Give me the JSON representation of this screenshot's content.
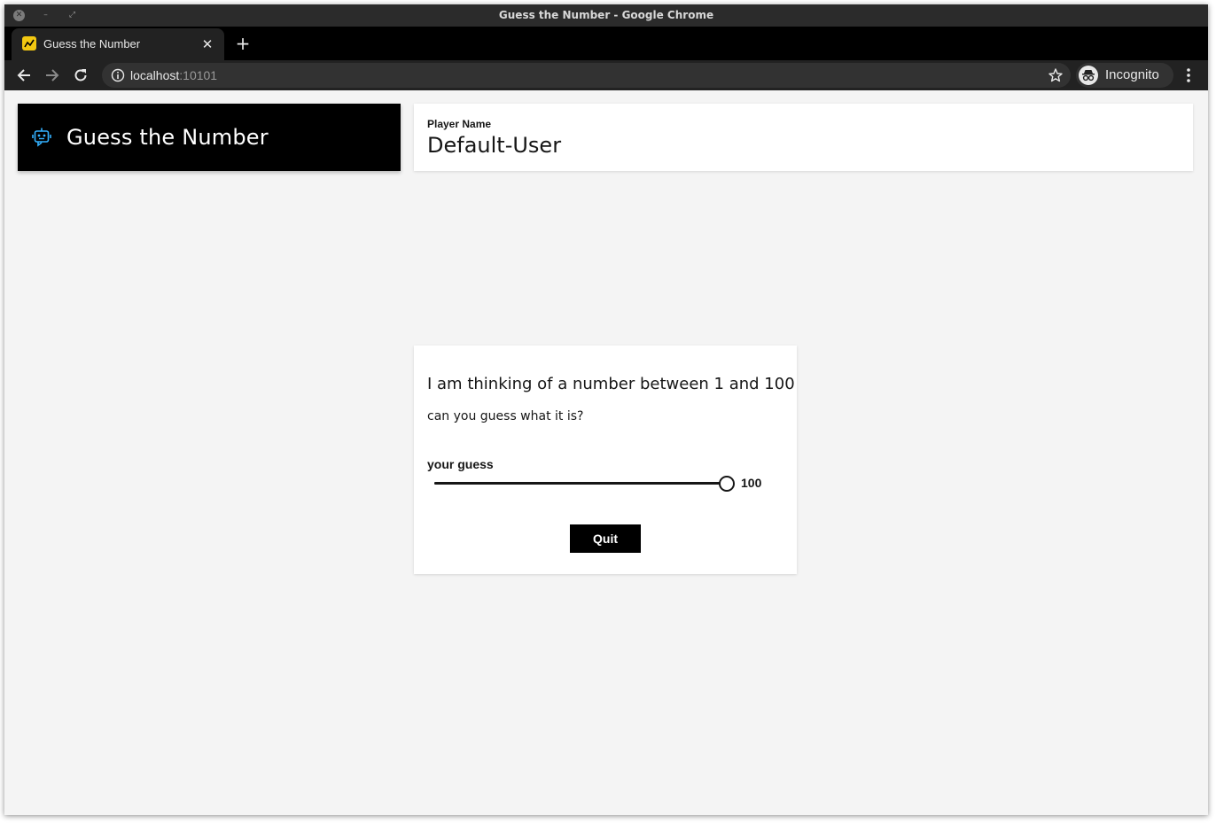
{
  "window": {
    "title": "Guess the Number - Google Chrome"
  },
  "tabs": [
    {
      "label": "Guess the Number",
      "active": true
    }
  ],
  "address_bar": {
    "host": "localhost",
    "port": ":10101"
  },
  "profile": {
    "label": "Incognito"
  },
  "icons": {
    "favicon": "chart-favicon-icon",
    "back": "arrow-left-icon",
    "forward": "arrow-right-icon",
    "reload": "reload-icon",
    "site_info": "info-icon",
    "bookmark": "star-icon",
    "incognito": "incognito-icon",
    "menu": "kebab-menu-icon",
    "app": "robot-icon"
  },
  "app": {
    "title": "Guess the Number",
    "accent_color": "#33b1ff"
  },
  "player": {
    "label": "Player Name",
    "value": "Default-User"
  },
  "game": {
    "headline": "I am thinking of a number between 1 and 100",
    "subline": "can you guess what it is?",
    "guess_label": "your guess",
    "slider": {
      "min": 1,
      "max": 100,
      "value": 100
    },
    "slider_display": "100",
    "quit_label": "Quit"
  }
}
